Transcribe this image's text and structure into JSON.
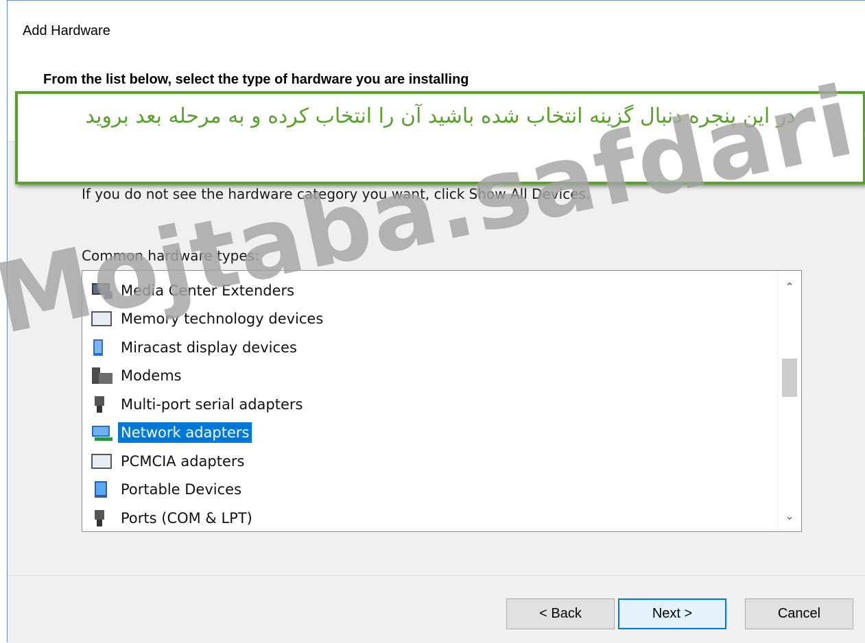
{
  "window": {
    "title": "Add Hardware",
    "heading": "From the list below, select the type of hardware you are installing"
  },
  "callout": {
    "text": "در این پنجره دنبال گزینه انتخاب شده باشید آن را انتخاب کرده و به مرحله بعد بروید",
    "color": "#5aa02c"
  },
  "body": {
    "hint": "If you do not see the hardware category you want, click Show All Devices.",
    "list_label": "Common hardware types:"
  },
  "list": {
    "items": [
      {
        "label": "Media Center Extenders",
        "icon": "media-center-icon"
      },
      {
        "label": "Memory technology devices",
        "icon": "memory-device-icon"
      },
      {
        "label": "Miracast display devices",
        "icon": "miracast-icon"
      },
      {
        "label": "Modems",
        "icon": "modem-icon"
      },
      {
        "label": "Multi-port serial adapters",
        "icon": "serial-port-icon"
      },
      {
        "label": "Network adapters",
        "icon": "network-adapter-icon"
      },
      {
        "label": "PCMCIA adapters",
        "icon": "pcmcia-icon"
      },
      {
        "label": "Portable Devices",
        "icon": "portable-device-icon"
      },
      {
        "label": "Ports (COM & LPT)",
        "icon": "port-icon"
      }
    ],
    "selected": "Network adapters",
    "selection_color": "#0078d7"
  },
  "buttons": {
    "back": "< Back",
    "next": "Next >",
    "cancel": "Cancel"
  },
  "watermark": {
    "text": "Mojtaba.safdari.ms@gm"
  }
}
